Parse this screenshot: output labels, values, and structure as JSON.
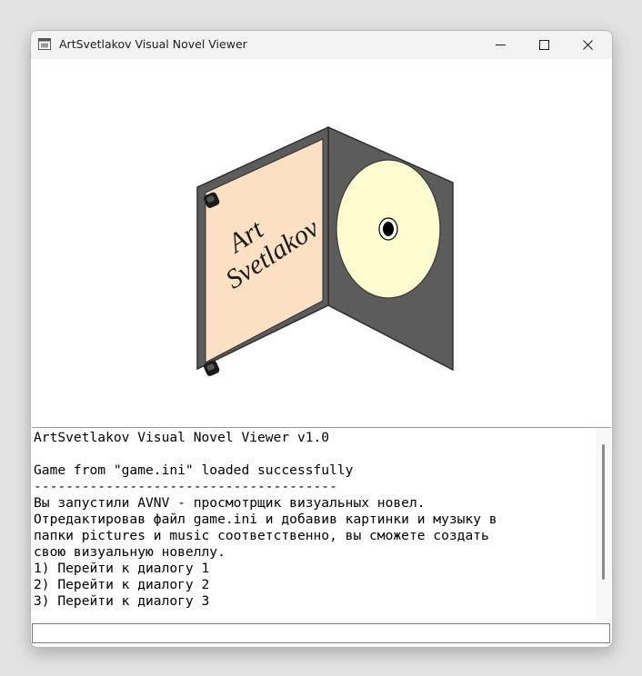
{
  "window": {
    "title": "ArtSvetlakov Visual Novel Viewer"
  },
  "artwork": {
    "cover_line1": "Art",
    "cover_line2": "Svetlakov",
    "cover_color": "#fce0c4",
    "case_color": "#5c5c5c",
    "disc_color": "#fffccf"
  },
  "console": {
    "lines": [
      "ArtSvetlakov Visual Novel Viewer v1.0",
      "",
      "Game from \"game.ini\" loaded successfully",
      "--------------------------------------",
      "Вы запустили AVNV - просмотрщик визуальных новел.",
      "Отредактировав файл game.ini и добавив картинки и музыку в",
      "папки pictures и music соответственно, вы сможете создать",
      "свою визуальную новеллу.",
      "1) Перейти к диалогу 1",
      "2) Перейти к диалогу 2",
      "3) Перейти к диалогу 3"
    ]
  },
  "input": {
    "value": ""
  }
}
